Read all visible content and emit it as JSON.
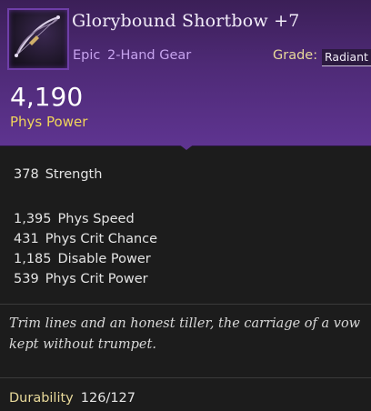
{
  "item": {
    "name": "Glorybound Shortbow +7",
    "rarity": "Epic",
    "slot": "2-Hand Gear",
    "grade_label": "Grade:",
    "grade_value": "Radiant",
    "icon": "shortbow-icon"
  },
  "power": {
    "value": "4,190",
    "label": "Phys Power"
  },
  "base_stats": [
    {
      "value": "378",
      "name": "Strength"
    }
  ],
  "sub_stats": [
    {
      "value": "1,395",
      "name": "Phys Speed"
    },
    {
      "value": "431",
      "name": "Phys Crit Chance"
    },
    {
      "value": "1,185",
      "name": "Disable Power"
    },
    {
      "value": "539",
      "name": "Phys Crit Power"
    }
  ],
  "lore": {
    "line1": "Trim lines and an honest tiller, the carriage of a vow",
    "line2": "kept without trumpet."
  },
  "durability": {
    "label": "Durability",
    "value": "126/127"
  },
  "colors": {
    "header_purple": "#5e3490",
    "rarity_text": "#c6a3ee",
    "power_label": "#f0d45a",
    "grade_label": "#e8d99a"
  }
}
